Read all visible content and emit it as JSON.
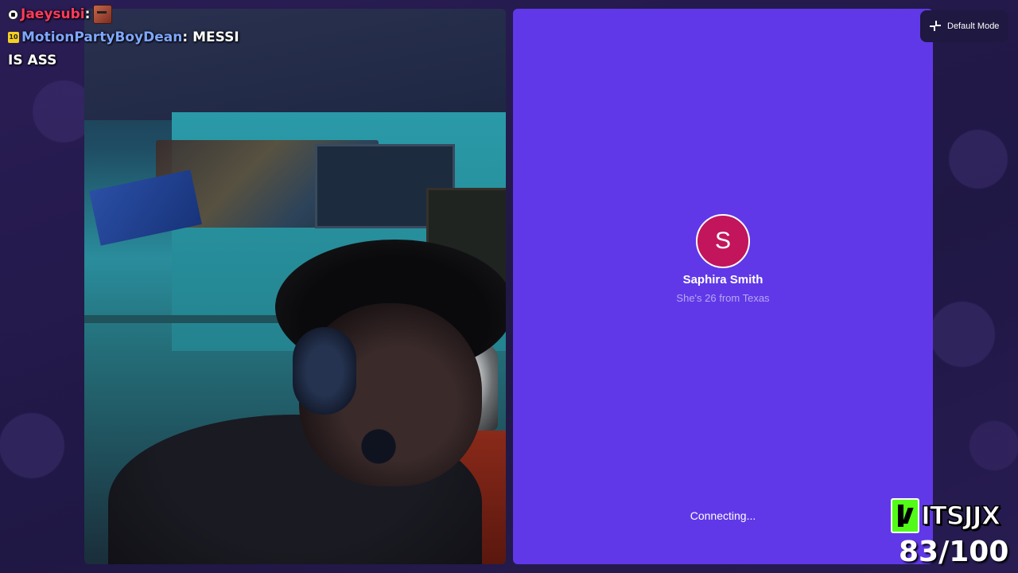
{
  "chat": {
    "messages": [
      {
        "badge": "soccer-ball-badge",
        "user": "Jaeysubi",
        "separator": ":",
        "text": "",
        "emote": "face-emote"
      },
      {
        "badge": "subscriber-badge",
        "badge_text": "10",
        "user": "MotionPartyBoyDean",
        "separator": ":",
        "text": "MESSI IS ASS"
      }
    ]
  },
  "partner": {
    "avatar_initial": "S",
    "name": "Saphira Smith",
    "subtitle": "She's 26 from Texas",
    "status": "Connecting..."
  },
  "mode_button": {
    "label": "Default Mode",
    "icon": "minimize-icon"
  },
  "branding": {
    "channel": "ITSJJX",
    "goal": "83/100"
  },
  "colors": {
    "background": "#241a4a",
    "partner_panel": "#6038e8",
    "avatar": "#c2155c",
    "kick_green": "#53fc18",
    "user_jaey": "#ff3b5c",
    "user_dean": "#7fa7ff"
  }
}
